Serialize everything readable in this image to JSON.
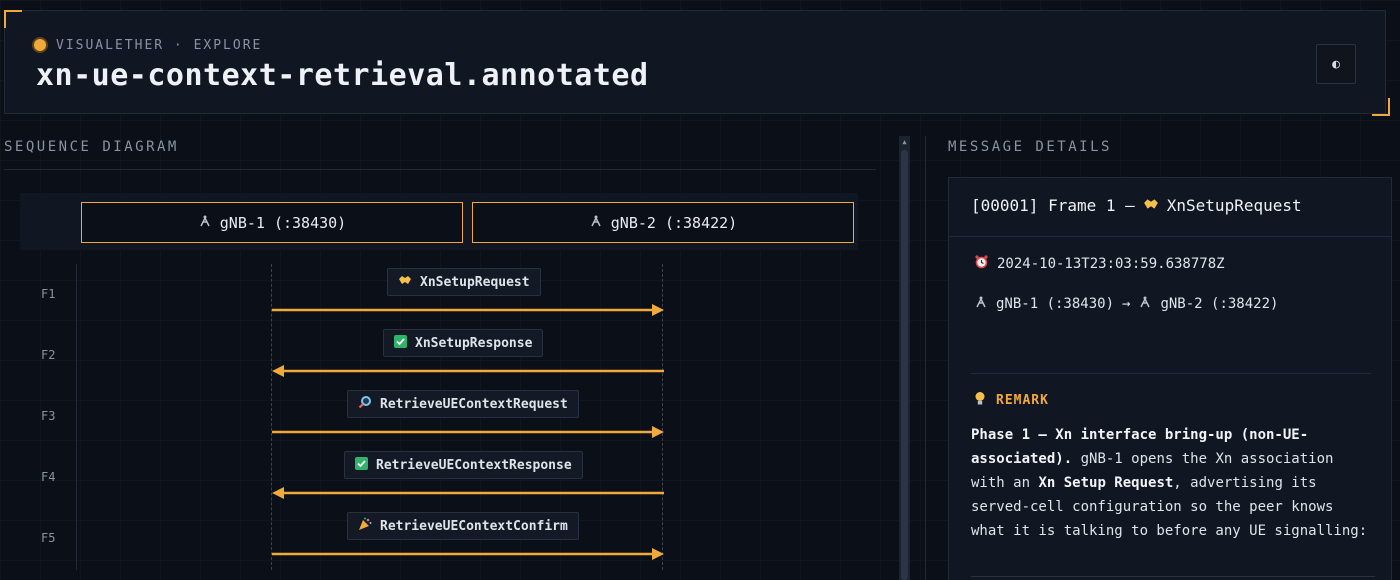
{
  "header": {
    "eyebrow": "VISUALETHER · EXPLORE",
    "title": "xn-ue-context-retrieval.annotated",
    "theme_toggle_glyph": "◐"
  },
  "sections": {
    "sequence": "SEQUENCE DIAGRAM",
    "details": "MESSAGE DETAILS"
  },
  "icons": {
    "antenna": "antenna-icon",
    "handshake": "handshake-icon",
    "check": "check-icon",
    "magnifier": "magnifier-icon",
    "party": "party-icon",
    "alarm": "alarm-clock-icon",
    "bulb": "lightbulb-icon"
  },
  "colors": {
    "accent": "#f0a93a",
    "background": "#0b0f17",
    "panel": "#111722",
    "check_green": "#2fb36b"
  },
  "participants": [
    {
      "label": "gNB-1 (:38430)"
    },
    {
      "label": "gNB-2 (:38422)"
    }
  ],
  "messages": [
    {
      "frame": "F1",
      "label": "XnSetupRequest",
      "icon": "handshake",
      "direction": "right"
    },
    {
      "frame": "F2",
      "label": "XnSetupResponse",
      "icon": "check",
      "direction": "left"
    },
    {
      "frame": "F3",
      "label": "RetrieveUEContextRequest",
      "icon": "magnifier",
      "direction": "right"
    },
    {
      "frame": "F4",
      "label": "RetrieveUEContextResponse",
      "icon": "check",
      "direction": "left"
    },
    {
      "frame": "F5",
      "label": "RetrieveUEContextConfirm",
      "icon": "party",
      "direction": "right"
    }
  ],
  "details": {
    "title_prefix": "[00001] Frame 1 —",
    "title_message": "XnSetupRequest",
    "timestamp": "2024-10-13T23:03:59.638778Z",
    "from": "gNB-1 (:38430)",
    "arrow": "→",
    "to": "gNB-2 (:38422)",
    "remark_label": "REMARK",
    "remark": {
      "bold_1": "Phase 1 — Xn interface bring-up (non-UE-associated).",
      "text_1": " gNB-1 opens the Xn association with an ",
      "bold_2": "Xn Setup Request",
      "text_2": ", advertising its served-cell configuration so the peer knows what it is talking to before any UE signalling:"
    }
  }
}
